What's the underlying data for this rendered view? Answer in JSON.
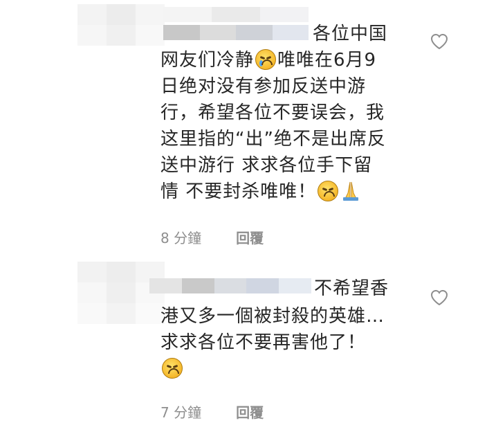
{
  "comments": [
    {
      "lines": [
        {
          "pre": "各位中国",
          "emoji": null
        },
        {
          "pre": "网友们冷静",
          "emoji": "cry",
          "post": "唯唯在6月9"
        },
        {
          "pre": "日绝对没有参加反送中游",
          "emoji": null
        },
        {
          "pre": "行，希望各位不要误会，我",
          "emoji": null
        },
        {
          "pre": "这里指的“出”绝不是出席反",
          "emoji": null
        },
        {
          "pre": "送中游行 求求各位手下留",
          "emoji": null
        },
        {
          "pre": "情 不要封杀唯唯！",
          "emoji": "confounded",
          "emoji2": "pray"
        }
      ],
      "time": "8 分鐘",
      "reply": "回覆",
      "icons": {
        "like": "heart-outline-icon",
        "emoji1": "crying-face-emoji",
        "emoji2": "confounded-face-emoji",
        "emoji3": "folded-hands-emoji"
      }
    },
    {
      "lines": [
        {
          "pre": "不希望香",
          "emoji": null
        },
        {
          "pre": "港又多一個被封殺的英雄…",
          "emoji": null
        },
        {
          "pre": "求求各位不要再害他了！",
          "emoji": null
        },
        {
          "pre": "",
          "emoji": "confounded"
        }
      ],
      "time": "7 分鐘",
      "reply": "回覆",
      "icons": {
        "like": "heart-outline-icon",
        "emoji1": "confounded-face-emoji"
      }
    }
  ],
  "colors": {
    "text": "#262626",
    "meta": "#8e8e8e",
    "background": "#ffffff"
  }
}
